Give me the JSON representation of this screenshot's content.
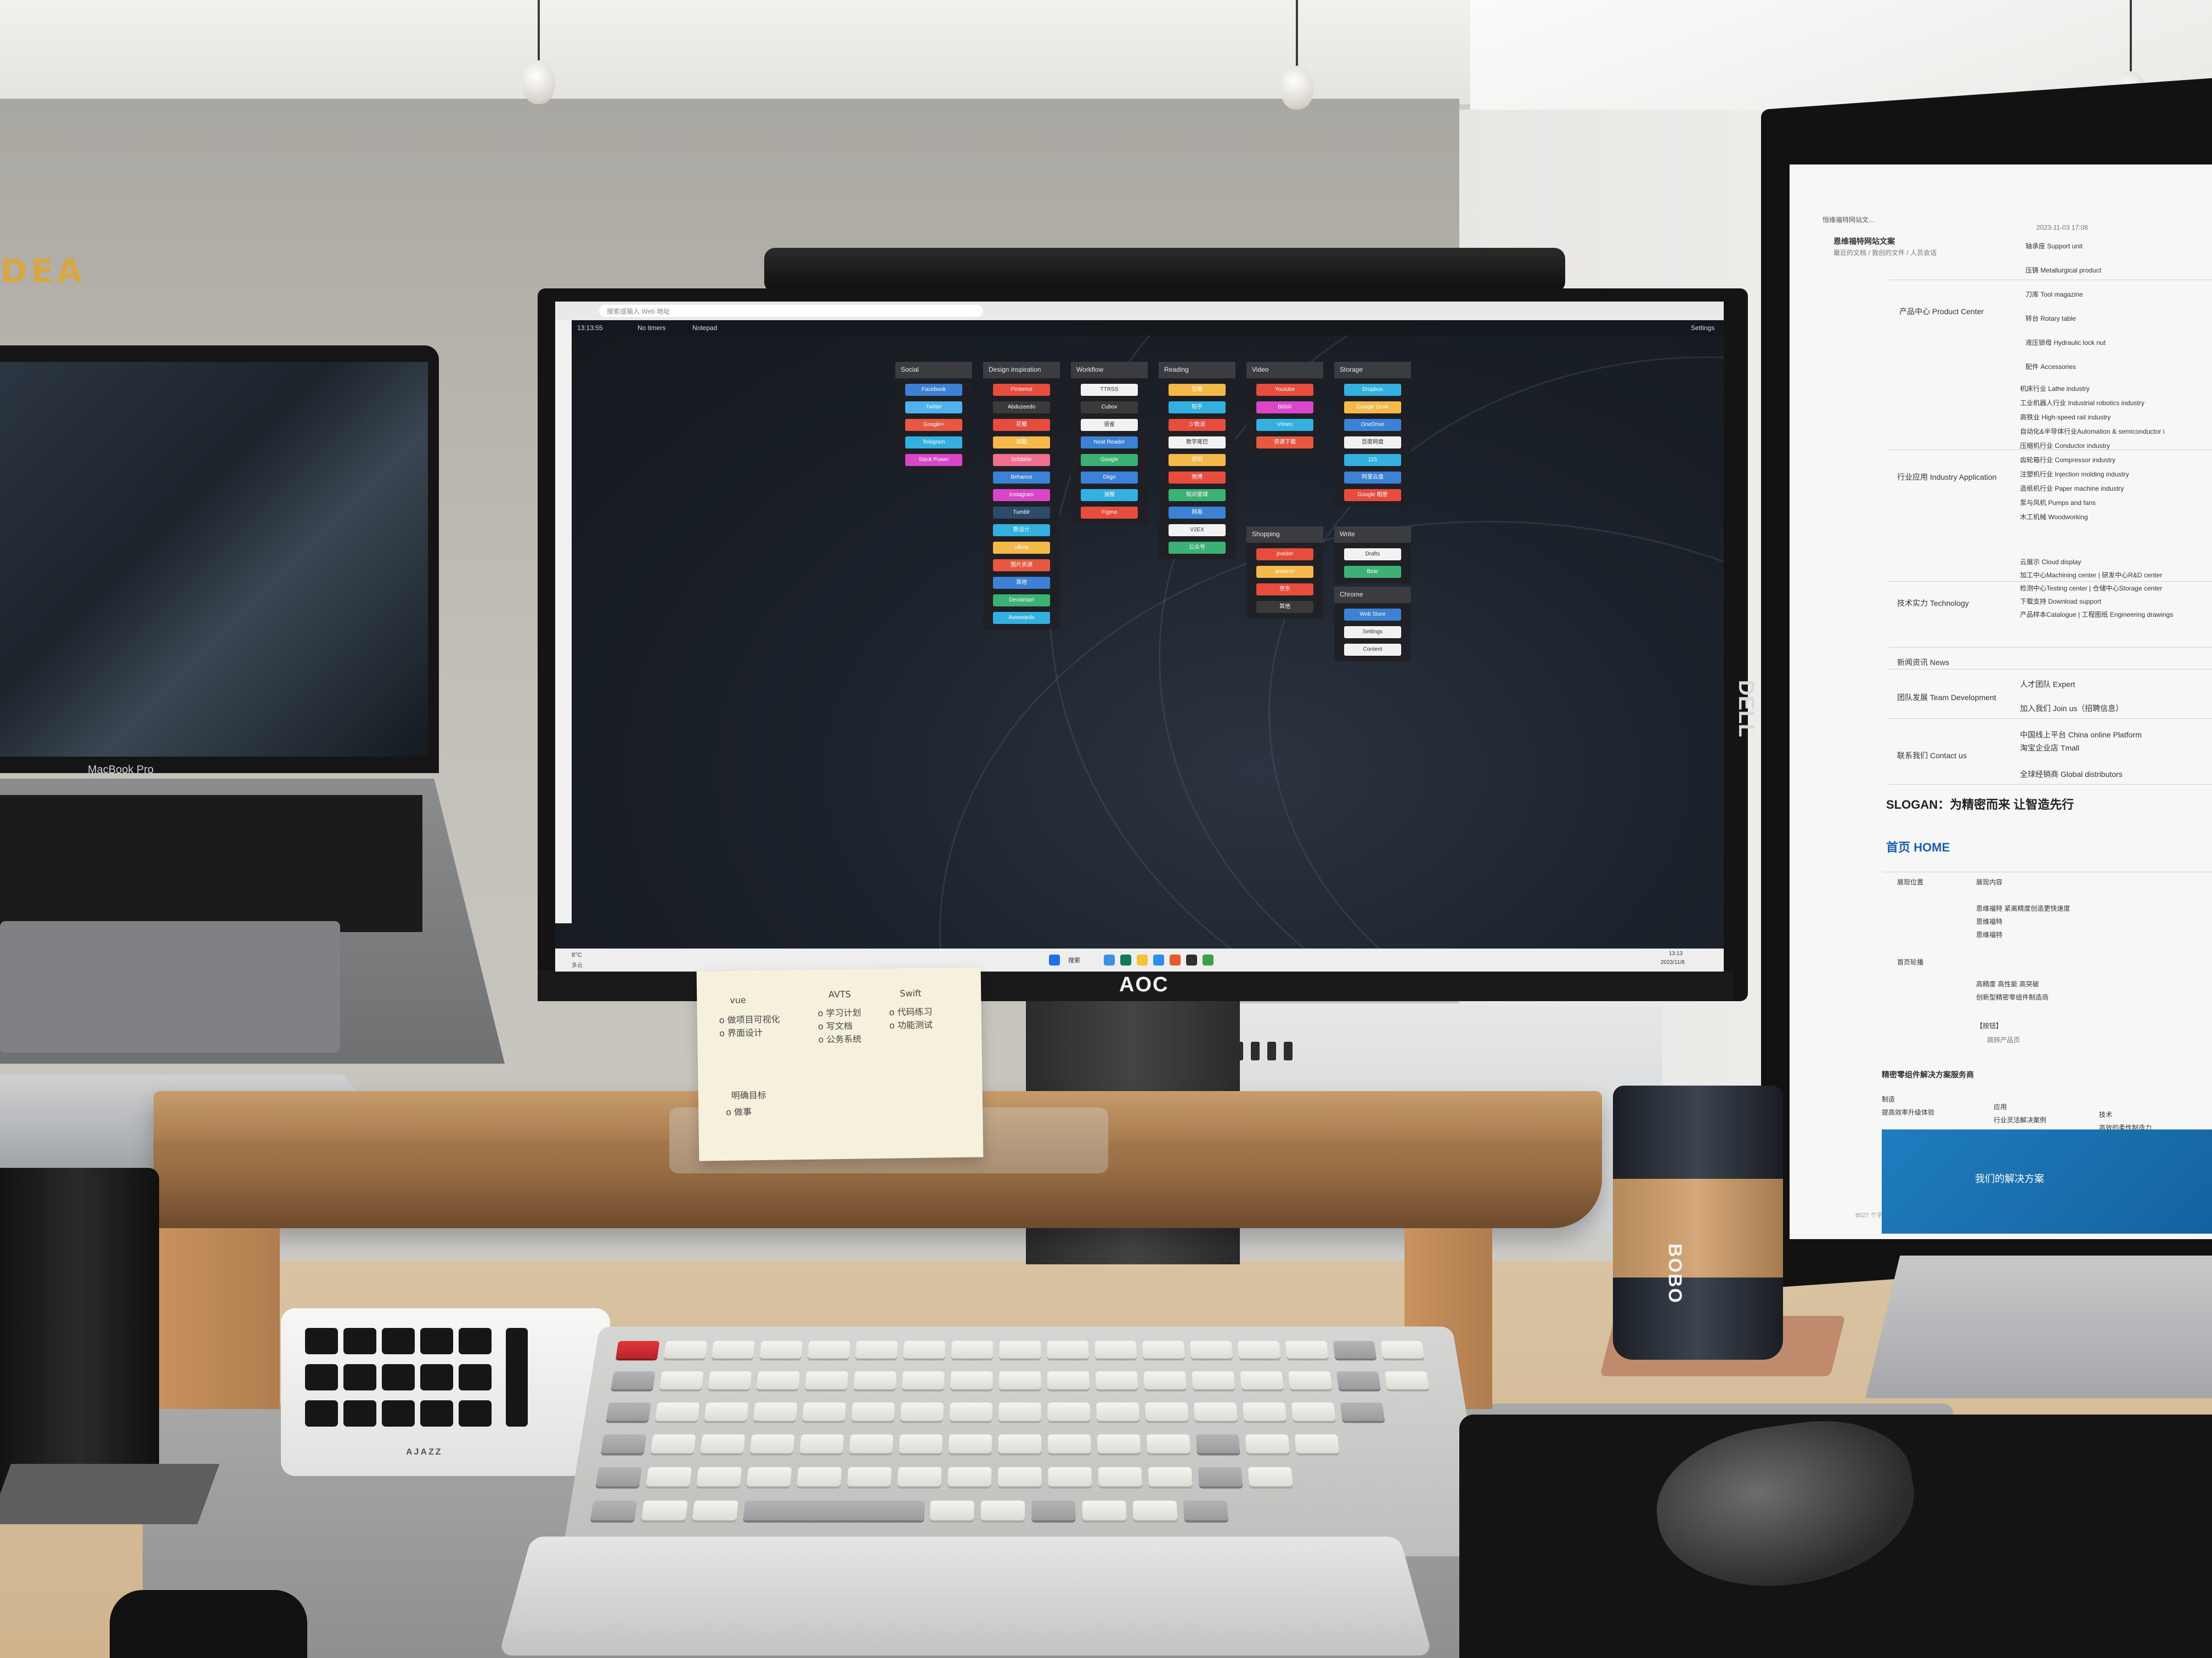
{
  "scene": {
    "wall_sign": "DEA",
    "laptop_label": "MacBook Pro",
    "aoc_brand": "AOC",
    "dell_brand": "DELL",
    "cup_brand": "BOBO",
    "macropad_brand": "AJAZZ"
  },
  "browser": {
    "url_placeholder": "搜索或输入 Web 地址",
    "clock": "13:13:55",
    "timers_label": "No timers",
    "notepad_label": "Notepad",
    "settings_label": "Settings",
    "taskbar_weather": "8°C",
    "taskbar_weather_sub": "多云",
    "taskbar_search": "搜索",
    "taskbar_time": "13:13",
    "taskbar_date": "2023/11/8"
  },
  "bookmark_columns": [
    {
      "title": "Social",
      "links": [
        {
          "label": "Facebook",
          "color": "#3b82d6"
        },
        {
          "label": "Twitter",
          "color": "#4fb2ee"
        },
        {
          "label": "Google+",
          "color": "#e8573f"
        },
        {
          "label": "Telegram",
          "color": "#34b0e0"
        },
        {
          "label": "Slack Power",
          "color": "#d946c7"
        }
      ]
    },
    {
      "title": "Design inspiration",
      "links": [
        {
          "label": "Pinterest",
          "color": "#e84c3d"
        },
        {
          "label": "Abduzeedo",
          "color": "#3a3a3a"
        },
        {
          "label": "花瓣",
          "color": "#e84c3d"
        },
        {
          "label": "站酷",
          "color": "#f5b94a"
        },
        {
          "label": "Dribbble",
          "color": "#ef6f8c"
        },
        {
          "label": "Behance",
          "color": "#3b82d6"
        },
        {
          "label": "Instagram",
          "color": "#d946c7"
        },
        {
          "label": "Tumblr",
          "color": "#2e4a6b"
        },
        {
          "label": "数设计",
          "color": "#34b0e0"
        },
        {
          "label": "uiboa",
          "color": "#f5b94a"
        },
        {
          "label": "图片资源",
          "color": "#e8573f"
        },
        {
          "label": "其他",
          "color": "#3b82d6"
        },
        {
          "label": "Deviantart",
          "color": "#3bb273"
        },
        {
          "label": "Awwwards",
          "color": "#34b0e0"
        }
      ]
    },
    {
      "title": "Workflow",
      "links": [
        {
          "label": "TTRSS",
          "color": "#f2f2f2"
        },
        {
          "label": "Cubox",
          "color": "#3a3a3a"
        },
        {
          "label": "语雀",
          "color": "#f2f2f2"
        },
        {
          "label": "Neat Reader",
          "color": "#3b82d6"
        },
        {
          "label": "Google",
          "color": "#3bb273"
        },
        {
          "label": "Diigo",
          "color": "#3b82d6"
        },
        {
          "label": "油猴",
          "color": "#34b0e0"
        },
        {
          "label": "Figma",
          "color": "#e84c3d"
        }
      ]
    },
    {
      "title": "Reading",
      "links": [
        {
          "label": "豆瓣",
          "color": "#f5b94a"
        },
        {
          "label": "知乎",
          "color": "#34b0e0"
        },
        {
          "label": "少数派",
          "color": "#e84c3d"
        },
        {
          "label": "数字尾巴",
          "color": "#f2f2f2"
        },
        {
          "label": "即刻",
          "color": "#f5b94a"
        },
        {
          "label": "微博",
          "color": "#e84c3d"
        },
        {
          "label": "知识星球",
          "color": "#3bb273"
        },
        {
          "label": "网易",
          "color": "#3b82d6"
        },
        {
          "label": "V2EX",
          "color": "#f2f2f2"
        },
        {
          "label": "公众号",
          "color": "#3bb273"
        }
      ]
    },
    {
      "title": "Video",
      "links": [
        {
          "label": "Youtube",
          "color": "#e84c3d"
        },
        {
          "label": "Bilibili",
          "color": "#d946c7"
        },
        {
          "label": "Vimeo",
          "color": "#34b0e0"
        },
        {
          "label": "资源下载",
          "color": "#e8573f"
        }
      ]
    },
    {
      "title": "Storage",
      "links": [
        {
          "label": "Dropbox",
          "color": "#34b0e0"
        },
        {
          "label": "Google Drive",
          "color": "#f5b94a"
        },
        {
          "label": "OneDrive",
          "color": "#3b82d6"
        },
        {
          "label": "百度网盘",
          "color": "#f2f2f2"
        },
        {
          "label": "115",
          "color": "#34b0e0"
        },
        {
          "label": "阿里云盘",
          "color": "#3b82d6"
        },
        {
          "label": "Google 相册",
          "color": "#e84c3d"
        }
      ]
    },
    {
      "title": "Shopping",
      "links": [
        {
          "label": "jmeder",
          "color": "#e84c3d"
        },
        {
          "label": "amazon",
          "color": "#f5b94a"
        },
        {
          "label": "京东",
          "color": "#e84c3d"
        },
        {
          "label": "其他",
          "color": "#3a3a3a"
        }
      ]
    },
    {
      "title": "Write",
      "links": [
        {
          "label": "Drafts",
          "color": "#f2f2f2"
        },
        {
          "label": "Bear",
          "color": "#3bb273"
        }
      ]
    },
    {
      "title": "Chrome",
      "links": [
        {
          "label": "Web Store",
          "color": "#3b82d6"
        },
        {
          "label": "Settings",
          "color": "#f2f2f2"
        },
        {
          "label": "Content",
          "color": "#f2f2f2"
        }
      ]
    }
  ],
  "document": {
    "tab_title": "恒维福特网站文...",
    "title": "恩维福特网站文案",
    "breadcrumb": "最近的文档 / 我创的文件 / 人员会话",
    "date": "2023-11-03 17:08",
    "product_center": "产品中心 Product Center",
    "products": [
      "轴承座 Support unit",
      "压铸 Metallurgical product",
      "刀库 Tool magazine",
      "转台 Rotary table",
      "液压锁母 Hydraulic lock nut",
      "配件 Accessories"
    ],
    "industry_app": "行业应用 Industry Application",
    "industries": [
      "机床行业 Lathe industry",
      "工业机器人行业 Industrial robotics industry",
      "高铁业 High-speed rail industry",
      "自动化&半导体行业Automation & semiconductor i",
      "压缩机行业 Conductor industry",
      "齿轮箱行业 Compressor industry",
      "注塑机行业 Injection molding industry",
      "造纸机行业 Paper machine industry",
      "泵与风机 Pumps and fans",
      "木工机械 Woodworking"
    ],
    "tech_strength": "技术实力 Technology",
    "tech": [
      "云展示 Cloud display",
      "加工中心Machining center | 研发中心R&D center",
      "检测中心Testing center | 仓储中心Storage center",
      "下载支持 Download support",
      "产品样本Catalogue | 工程图纸 Engineering drawings"
    ],
    "news": "新闻资讯 News",
    "team": "团队发展 Team Development",
    "team_items": [
      "人才团队 Expert",
      "加入我们 Join us（招聘信息）"
    ],
    "contact": "联系我们 Contact us",
    "contact_items": [
      "中国线上平台 China online Platform",
      "淘宝企业店 Tmall",
      "全球经销商 Global distributors"
    ],
    "slogan": "SLOGAN：为精密而来 让智造先行",
    "home_heading": "首页 HOME",
    "table_head": [
      "展现位置",
      "展现内容"
    ],
    "home_rows": [
      "恩维福特 紧离精度创造更快速度",
      "恩维福特",
      "恩维福特"
    ],
    "home_label": "首页轮播",
    "home_rows2": [
      "高精度  高性能  高突破",
      "创新型精密零组件制造商"
    ],
    "home_btn": "【按钮】",
    "home_link": "跳转产品页",
    "section2": "精密零组件解决方案服务商",
    "cols3": [
      "制造",
      "应用",
      "技术"
    ],
    "cols3_sub": [
      "提高效率升级体验",
      "行业灵活解决案例",
      "高效的柔性制造力"
    ],
    "banner_title": "我们的解决方案",
    "word_count": "8527 个字"
  },
  "note": {
    "col1_title": "vue",
    "col1_items": [
      "o 做项目可视化",
      "o 界面设计"
    ],
    "col2_title": "AVTS",
    "col2_items": [
      "o 学习计划",
      "o 写文档",
      "o 公务系统"
    ],
    "col3_title": "Swift",
    "col3_items": [
      "o 代码练习",
      "o 功能测试"
    ],
    "footer_title": "明确目标",
    "footer_item": "o 做事"
  }
}
